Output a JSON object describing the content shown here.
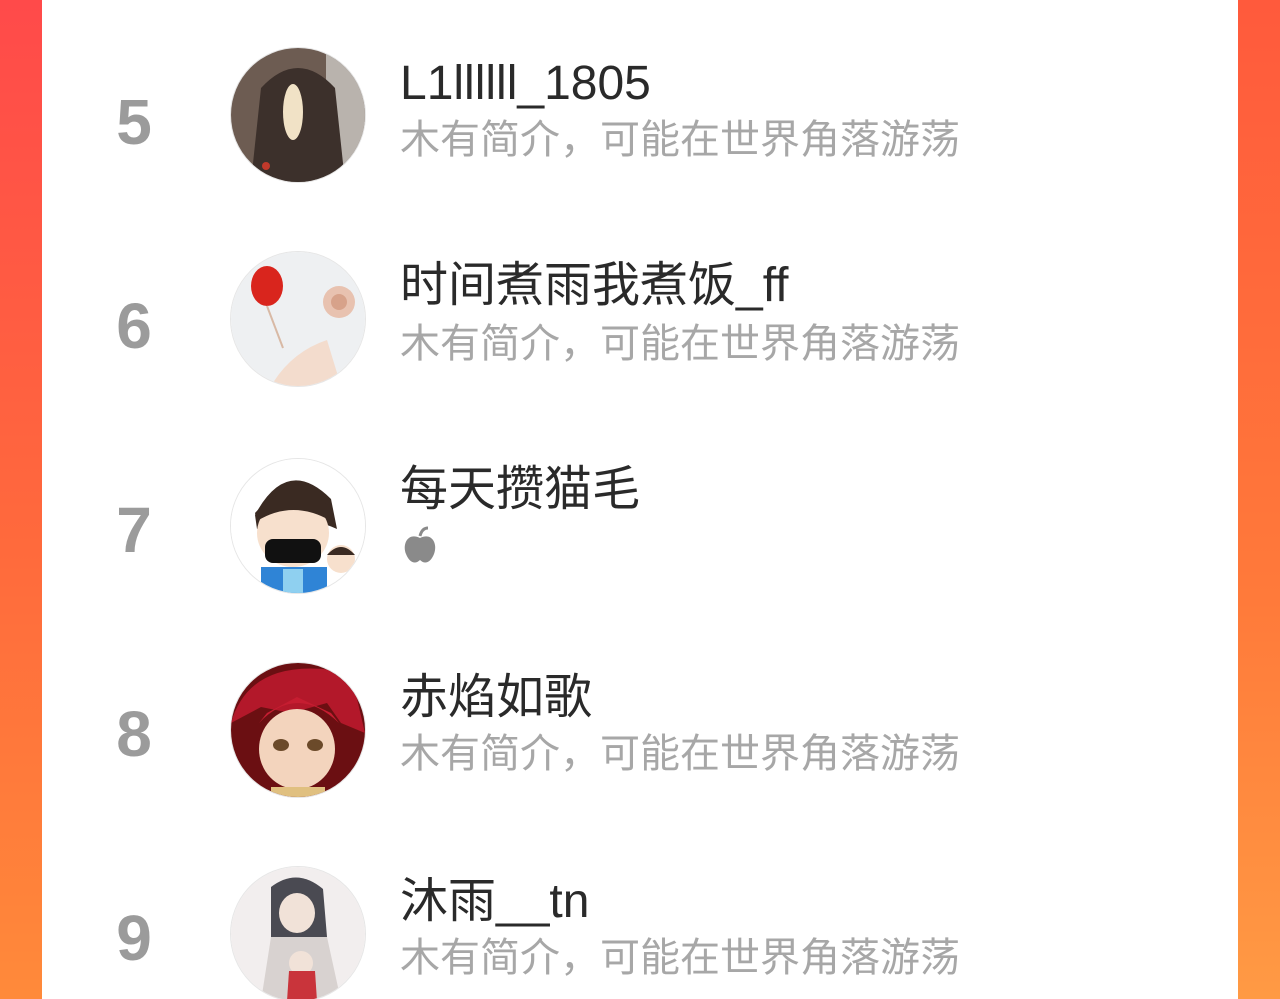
{
  "accent_colors": {
    "frame": "#ff4a4a",
    "panel": "#ffffff",
    "rank_text": "#9b9b9b",
    "name_text": "#2a2a2a",
    "bio_text": "#a7a7a7"
  },
  "ranking": {
    "items": [
      {
        "rank": "5",
        "name": "L1llllll_1805",
        "bio": "木有简介，可能在世界角落游荡",
        "avatar_icon": "avatar-hooded-figure"
      },
      {
        "rank": "6",
        "name": "时间煮雨我煮饭_ff",
        "bio": "木有简介，可能在世界角落游荡",
        "avatar_icon": "avatar-red-balloon-flower"
      },
      {
        "rank": "7",
        "name": "每天攒猫毛",
        "bio": "",
        "bio_icon": "apple-icon",
        "avatar_icon": "avatar-cartoon-boy-mask"
      },
      {
        "rank": "8",
        "name": "赤焰如歌",
        "bio": "木有简介，可能在世界角落游荡",
        "avatar_icon": "avatar-red-hair-anime"
      },
      {
        "rank": "9",
        "name": "沐雨__tn",
        "bio": "木有简介，可能在世界角落游荡",
        "avatar_icon": "avatar-ink-painting-figures"
      }
    ]
  }
}
